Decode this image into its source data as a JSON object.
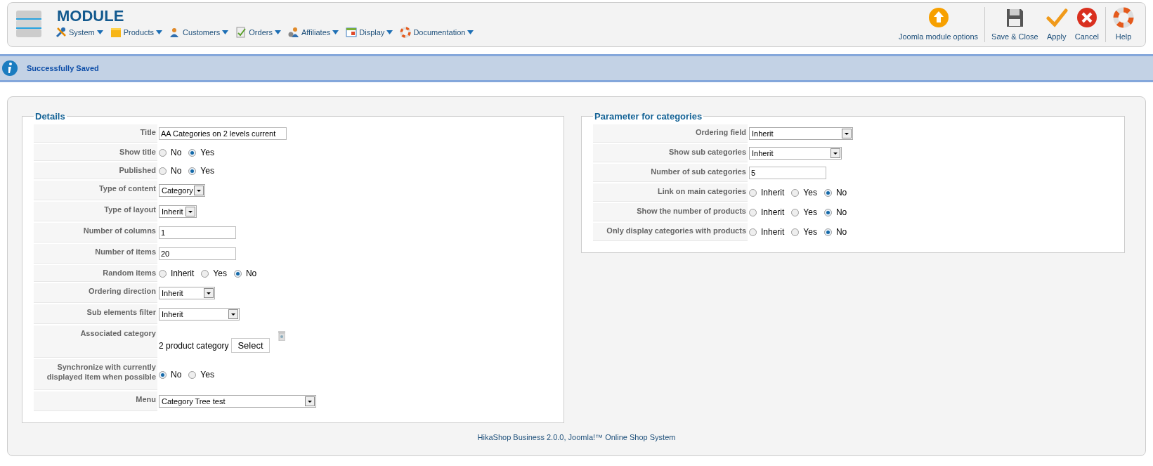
{
  "header": {
    "title": "MODULE",
    "menu": [
      {
        "label": "System"
      },
      {
        "label": "Products"
      },
      {
        "label": "Customers"
      },
      {
        "label": "Orders"
      },
      {
        "label": "Affiliates"
      },
      {
        "label": "Display"
      },
      {
        "label": "Documentation"
      }
    ],
    "toolbar": [
      {
        "label": "Joomla module options"
      },
      {
        "label": "Save & Close"
      },
      {
        "label": "Apply"
      },
      {
        "label": "Cancel"
      },
      {
        "label": "Help"
      }
    ]
  },
  "message": "Successfully Saved",
  "details": {
    "legend": "Details",
    "rows": [
      {
        "label": "Title",
        "kind": "text",
        "value": "AA Categories on 2 levels current"
      },
      {
        "label": "Show title",
        "kind": "radio",
        "options": [
          {
            "label": "No",
            "selected": false
          },
          {
            "label": "Yes",
            "selected": true
          }
        ]
      },
      {
        "label": "Published",
        "kind": "radio",
        "options": [
          {
            "label": "No",
            "selected": false
          },
          {
            "label": "Yes",
            "selected": true
          }
        ]
      },
      {
        "label": "Type of content",
        "kind": "select",
        "value": "Category"
      },
      {
        "label": "Type of layout",
        "kind": "select",
        "value": "Inherit"
      },
      {
        "label": "Number of columns",
        "kind": "text",
        "value": "1"
      },
      {
        "label": "Number of items",
        "kind": "text",
        "value": "20"
      },
      {
        "label": "Random items",
        "kind": "radio",
        "options": [
          {
            "label": "Inherit",
            "selected": false
          },
          {
            "label": "Yes",
            "selected": false
          },
          {
            "label": "No",
            "selected": true
          }
        ]
      },
      {
        "label": "Ordering direction",
        "kind": "select",
        "value": "Inherit"
      },
      {
        "label": "Sub elements filter",
        "kind": "select",
        "value": "Inherit"
      },
      {
        "label": "Associated category",
        "kind": "category",
        "value": "2 product category",
        "button": "Select"
      },
      {
        "label": "Synchronize with currently displayed item when possible",
        "kind": "radio",
        "options": [
          {
            "label": "No",
            "selected": true
          },
          {
            "label": "Yes",
            "selected": false
          }
        ]
      },
      {
        "label": "Menu",
        "kind": "select",
        "value": "Category Tree test"
      }
    ]
  },
  "categories": {
    "legend": "Parameter for categories",
    "rows": [
      {
        "label": "Ordering field",
        "kind": "select",
        "value": "Inherit"
      },
      {
        "label": "Show sub categories",
        "kind": "select",
        "value": "Inherit"
      },
      {
        "label": "Number of sub categories",
        "kind": "text",
        "value": "5"
      },
      {
        "label": "Link on main categories",
        "kind": "radio",
        "options": [
          {
            "label": "Inherit",
            "selected": false
          },
          {
            "label": "Yes",
            "selected": false
          },
          {
            "label": "No",
            "selected": true
          }
        ]
      },
      {
        "label": "Show the number of products",
        "kind": "radio",
        "options": [
          {
            "label": "Inherit",
            "selected": false
          },
          {
            "label": "Yes",
            "selected": false
          },
          {
            "label": "No",
            "selected": true
          }
        ]
      },
      {
        "label": "Only display categories with products",
        "kind": "radio",
        "options": [
          {
            "label": "Inherit",
            "selected": false
          },
          {
            "label": "Yes",
            "selected": false
          },
          {
            "label": "No",
            "selected": true
          }
        ]
      }
    ]
  },
  "footer": "HikaShop Business 2.0.0, Joomla!™ Online Shop System"
}
